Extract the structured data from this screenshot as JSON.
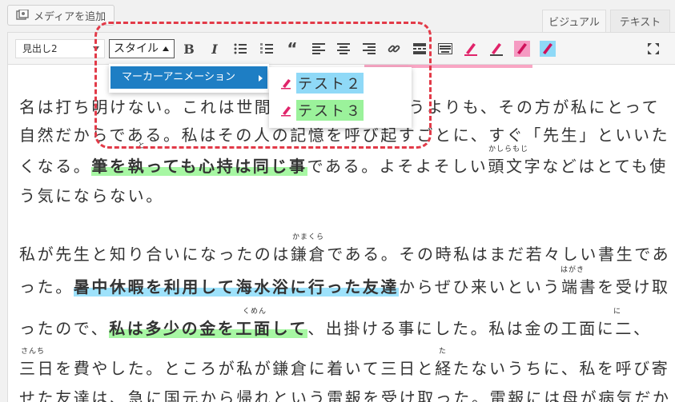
{
  "header": {
    "media_button": "メディアを追加",
    "tabs": [
      "ビジュアル",
      "テキスト"
    ]
  },
  "toolbar": {
    "format_select": "見出し2",
    "style_button": "スタイル"
  },
  "menus": {
    "level1": "マーカーアニメーション",
    "level2": [
      "テスト２",
      "テスト３"
    ]
  },
  "editor": {
    "lines": [
      {
        "a": "名は打ち明けない。これは世間",
        "b": "うよりも、その方が私にとって"
      },
      {
        "a": "自然だからである。私はその人の記憶を呼び起すごとに、すぐ「先生」といいた"
      },
      {
        "a": "くなる。",
        "hl": "筆を執っても心持は同じ事",
        "b": "である。よそよそしい頭文字などはとても使"
      },
      {
        "a": "う気にならない。"
      },
      {
        "a": "私が先生と知り合いになったのは鎌倉である。その時私はまだ若々しい書生であ"
      },
      {
        "a": "った。",
        "hl": "暑中休暇を利用して海水浴に行った友達",
        "b": "からぜひ来いという端書を受け取"
      },
      {
        "a": "ったので、",
        "hl": "私は多少の金を工面して",
        "b": "、出掛ける事にした。私は金の工面に二、"
      },
      {
        "a": "三日を費やした。ところが私が鎌倉に着いて三日と経たないうちに、私を呼び寄"
      },
      {
        "a": "せた友達は、急に国元から帰れという電報を受け取った。電報には母が病気だか"
      }
    ],
    "rubies": [
      "と",
      "かしらもじ",
      "かまくら",
      "はがき",
      "くめん",
      "に",
      "さんち",
      "た"
    ]
  },
  "colors": {
    "accent": "#1e7ec4",
    "marker_green": "#a7f7a3",
    "marker_blue": "#9ee2fb",
    "marker_pink": "#f9a6c4",
    "frame_red": "#e23a48"
  }
}
